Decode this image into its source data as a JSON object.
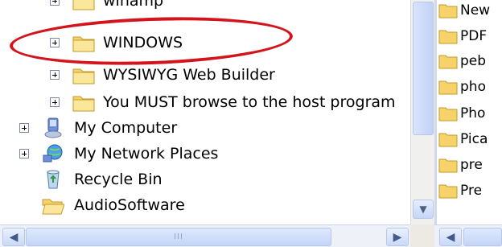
{
  "tree": {
    "items": [
      {
        "label": "winamp",
        "icon": "folder-icon",
        "expand": true
      },
      {
        "label": "WINDOWS",
        "icon": "folder-icon",
        "expand": true
      },
      {
        "label": "WYSIWYG Web Builder",
        "icon": "folder-icon",
        "expand": true
      },
      {
        "label": "You MUST browse to the host program",
        "icon": "folder-icon",
        "expand": true
      },
      {
        "label": "My Computer",
        "icon": "my-computer-icon",
        "expand": true
      },
      {
        "label": "My Network Places",
        "icon": "network-places-icon",
        "expand": true
      },
      {
        "label": "Recycle Bin",
        "icon": "recycle-bin-icon",
        "expand": false
      },
      {
        "label": "AudioSoftware",
        "icon": "folder-open-icon",
        "expand": false
      }
    ]
  },
  "right_pane": {
    "items": [
      {
        "label": "New"
      },
      {
        "label": "PDF"
      },
      {
        "label": "peb"
      },
      {
        "label": "pho"
      },
      {
        "label": "Pho"
      },
      {
        "label": "Pica"
      },
      {
        "label": "pre"
      },
      {
        "label": "Pre"
      }
    ]
  },
  "scrollbars": {
    "horizontal_grip": "III",
    "up_arrow": "▲",
    "down_arrow": "▼",
    "left_arrow": "◀",
    "right_arrow": "▶"
  },
  "colors": {
    "highlight_ellipse": "#d4141c",
    "folder_yellow": "#f5d36a",
    "scrollbar_blue": "#c6d6f7"
  }
}
